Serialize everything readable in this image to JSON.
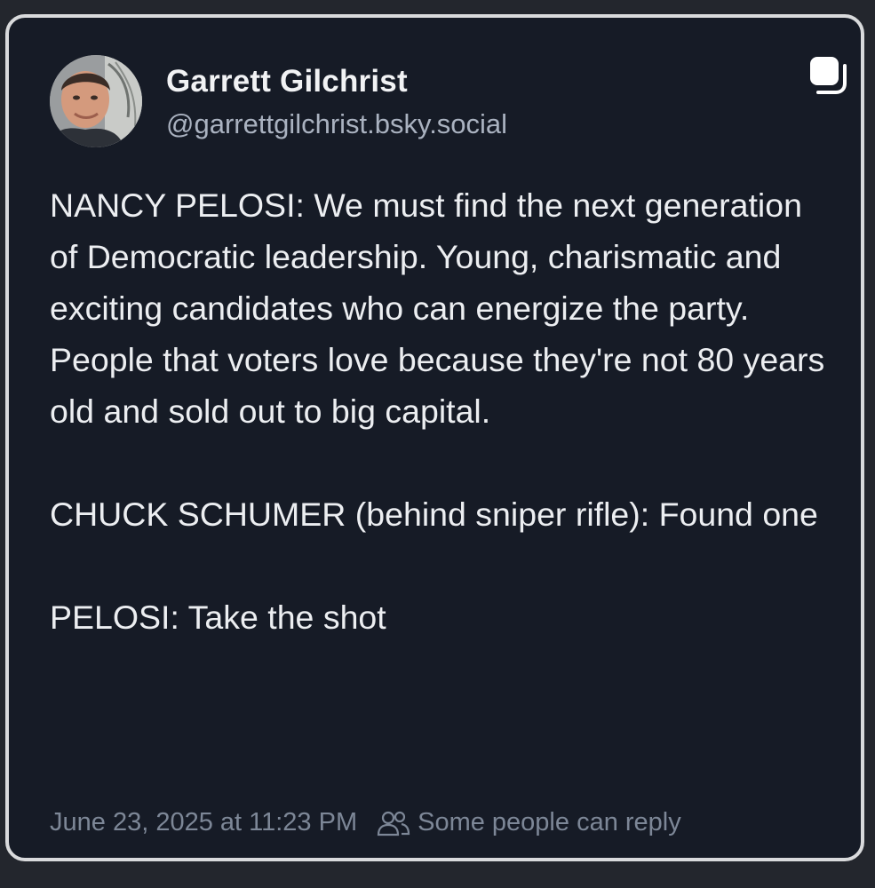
{
  "post": {
    "author_name": "Garrett Gilchrist",
    "author_handle": "@garrettgilchrist.bsky.social",
    "text": "NANCY PELOSI: We must find the next generation of Democratic leadership. Young, charismatic and exciting candidates who can energize the party. People that voters love because they're not 80 years old and sold out to big capital.\n\nCHUCK SCHUMER (behind sniper rifle): Found one\n\nPELOSI: Take the shot",
    "timestamp": "June 23, 2025 at 11:23 PM",
    "reply_setting": "Some people can reply"
  },
  "icons": {
    "avatar": "avatar-photo",
    "corner": "copy-squares-icon",
    "reply": "people-icon"
  },
  "colors": {
    "card_background": "#161b26",
    "card_border": "#d9dadc",
    "primary_text": "#eceef1",
    "handle_text": "#aab2c0",
    "meta_text": "#7d8797"
  }
}
